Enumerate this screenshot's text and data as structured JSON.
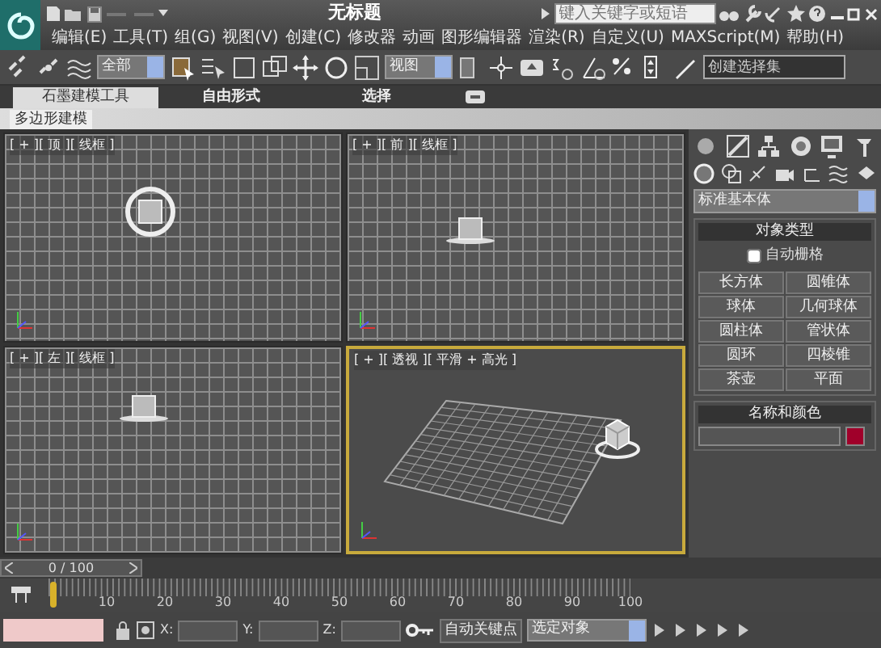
{
  "title_bar": {
    "title": "无标题",
    "search": {
      "placeholder": "键入关键字或短语"
    }
  },
  "menu": [
    "编辑(E)",
    "工具(T)",
    "组(G)",
    "视图(V)",
    "创建(C)",
    "修改器",
    "动画",
    "图形编辑器",
    "渲染(R)",
    "自定义(U)",
    "MAXScript(M)",
    "帮助(H)"
  ],
  "toolbar": {
    "selection_filter": "全部",
    "coord_system": "视图",
    "named_selection": {
      "placeholder": "创建选择集"
    }
  },
  "ribbon": {
    "tabs": [
      {
        "label": "石墨建模工具",
        "selected": true
      },
      {
        "label": "自由形式",
        "selected": false
      },
      {
        "label": "选择",
        "selected": false
      }
    ],
    "panel_button": "多边形建模"
  },
  "viewports": [
    {
      "label": "[ + ][ 顶 ][ 线框 ]",
      "kind": "top",
      "active": false
    },
    {
      "label": "[ + ][ 前 ][ 线框 ]",
      "kind": "front",
      "active": false
    },
    {
      "label": "[ + ][ 左 ][ 线框 ]",
      "kind": "left",
      "active": false
    },
    {
      "label": "[ + ][ 透视 ][ 平滑 + 高光 ]",
      "kind": "perspective",
      "active": true
    }
  ],
  "command_panel": {
    "category": "标准基本体",
    "object_type": {
      "title": "对象类型",
      "autogrid": {
        "label": "自动栅格",
        "checked": false
      },
      "buttons": [
        "长方体",
        "圆锥体",
        "球体",
        "几何球体",
        "圆柱体",
        "管状体",
        "圆环",
        "四棱锥",
        "茶壶",
        "平面"
      ]
    },
    "name_color": {
      "title": "名称和颜色",
      "color": "#a0002a"
    }
  },
  "timeline": {
    "slider": "0 / 100",
    "level": 0,
    "ticks": [
      "10",
      "20",
      "30",
      "40",
      "50",
      "60",
      "70",
      "80",
      "90",
      "100"
    ]
  },
  "status": {
    "coords": [
      "X:",
      "Y:",
      "Z:"
    ],
    "auto_key": "自动关键点",
    "key_filter": "选定对象"
  }
}
